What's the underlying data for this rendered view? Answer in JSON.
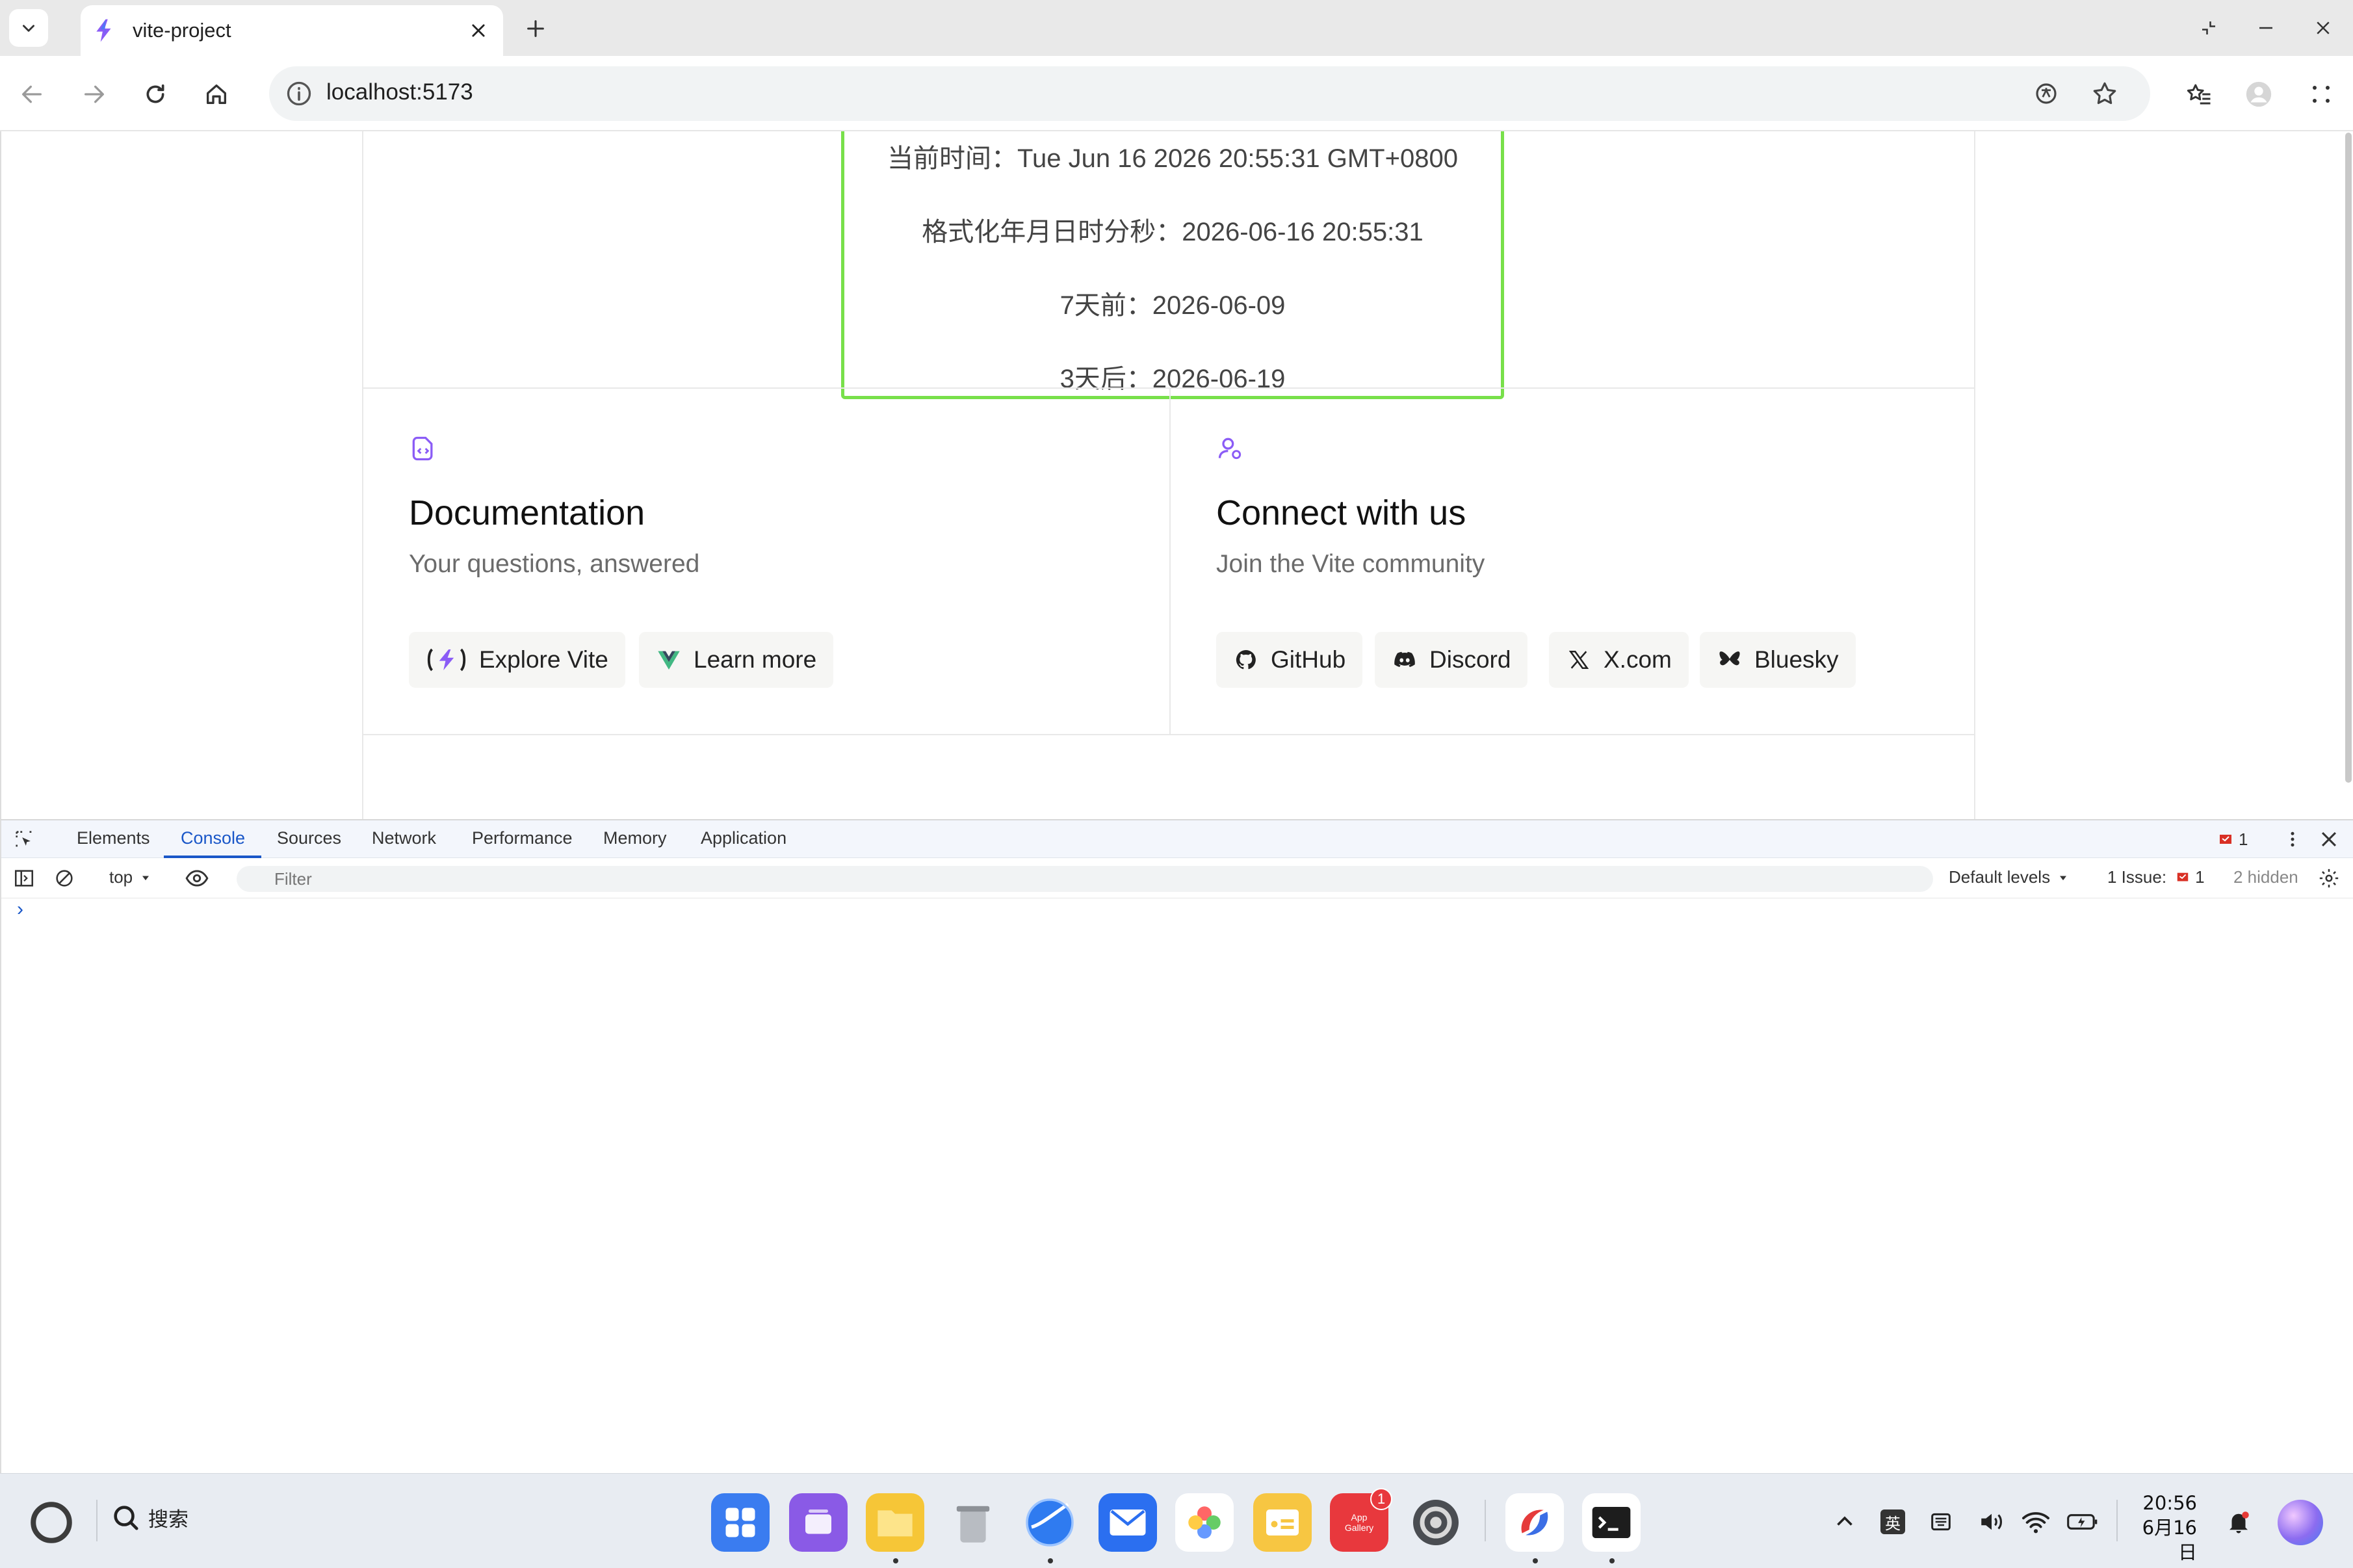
{
  "browser": {
    "tab_title": "vite-project",
    "url": "localhost:5173"
  },
  "page": {
    "time_lines": [
      "当前时间：Tue Jun 16 2026 20:55:31 GMT+0800",
      "格式化年月日时分秒：2026-06-16 20:55:31",
      "7天前：2026-06-09",
      "3天后：2026-06-19"
    ],
    "docs_card": {
      "title": "Documentation",
      "subtitle": "Your questions, answered",
      "buttons": [
        "Explore Vite",
        "Learn more"
      ]
    },
    "connect_card": {
      "title": "Connect with us",
      "subtitle": "Join the Vite community",
      "buttons": [
        "GitHub",
        "Discord",
        "X.com",
        "Bluesky"
      ]
    }
  },
  "devtools": {
    "tabs": [
      "Elements",
      "Console",
      "Sources",
      "Network",
      "Performance",
      "Memory",
      "Application"
    ],
    "active_tab": "Console",
    "issue_badge": "1",
    "context": "top",
    "filter_placeholder": "Filter",
    "levels": "Default levels",
    "issues_label": "1 Issue:",
    "issues_count": "1",
    "hidden": "2 hidden",
    "prompt": "›"
  },
  "taskbar": {
    "search_label": "搜索",
    "app_gallery_label": "App Gallery",
    "app_gallery_badge": "1",
    "ime": "英",
    "time": "20:56",
    "date": "6月16日"
  },
  "colors": {
    "accent": "#1a57c8",
    "highlight_box": "#78e04a",
    "vite_purple": "#8b5cf6",
    "vue_green": "#42b883"
  }
}
